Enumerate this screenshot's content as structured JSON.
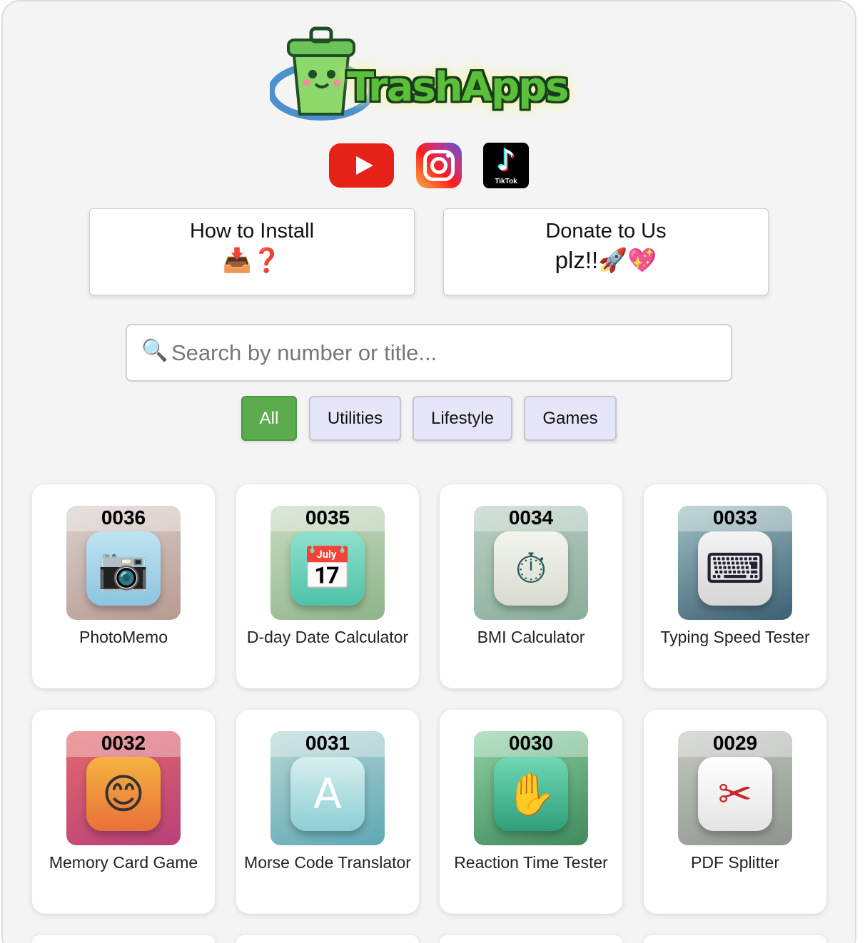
{
  "brand": {
    "logo_text": "TrashApps"
  },
  "social": [
    {
      "name": "YouTube",
      "icon": "youtube-icon",
      "color": "#e62117"
    },
    {
      "name": "Instagram",
      "icon": "instagram-icon"
    },
    {
      "name": "TikTok",
      "icon": "tiktok-icon",
      "label": "TikTok"
    }
  ],
  "buttons": {
    "install": {
      "line1": "How to Install",
      "line2": "📥❓"
    },
    "donate": {
      "line1": "Donate to Us",
      "line2": "plz!!🚀💖"
    }
  },
  "search": {
    "placeholder": "Search by number or title...",
    "value": "",
    "icon": "🔍"
  },
  "filters": [
    {
      "label": "All",
      "active": true
    },
    {
      "label": "Utilities",
      "active": false
    },
    {
      "label": "Lifestyle",
      "active": false
    },
    {
      "label": "Games",
      "active": false
    }
  ],
  "colors": {
    "active_filter": "#5cab4f",
    "filter_bg": "#e6e6fa",
    "page_bg": "#f4f4f4"
  },
  "apps": [
    {
      "number": "0036",
      "title": "PhotoMemo",
      "icon": "camera-icon",
      "glyph": "📷"
    },
    {
      "number": "0035",
      "title": "D-day Date Calculator",
      "icon": "calendar-icon",
      "glyph": "📅"
    },
    {
      "number": "0034",
      "title": "BMI Calculator",
      "icon": "scale-gauge-icon",
      "glyph": "⏱"
    },
    {
      "number": "0033",
      "title": "Typing Speed Tester",
      "icon": "keyboard-icon",
      "glyph": "⌨"
    },
    {
      "number": "0032",
      "title": "Memory Card Game",
      "icon": "emoji-grid-icon",
      "glyph": "😊"
    },
    {
      "number": "0031",
      "title": "Morse Code Translator",
      "icon": "letter-a-icon",
      "glyph": "A"
    },
    {
      "number": "0030",
      "title": "Reaction Time Tester",
      "icon": "hand-tap-icon",
      "glyph": "✋"
    },
    {
      "number": "0029",
      "title": "PDF Splitter",
      "icon": "pdf-scissors-icon",
      "glyph": "✂"
    }
  ]
}
